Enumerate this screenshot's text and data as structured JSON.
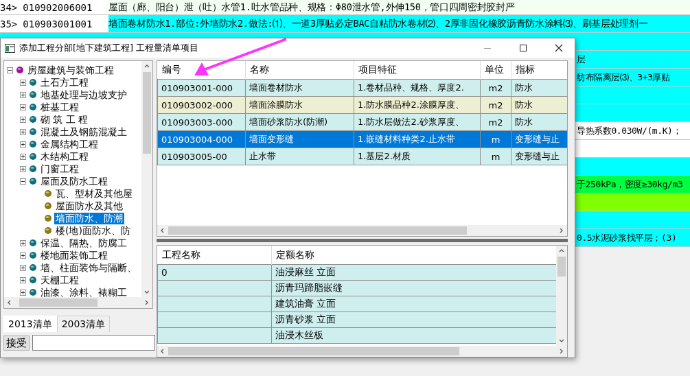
{
  "background_rows": [
    {
      "number": "34>",
      "code": "010902006001",
      "text": "屋面（廊、阳台）泄（吐）水管1.吐水管品种、规格：Φ80泄水管,外伸150，管口四周密封胶封严",
      "color": "#f4fff4"
    },
    {
      "number": "35>",
      "code": "010903001001",
      "text": "墙面卷材防水1.部位:外墙防水2.做法:⑴、一道3厚贴必定BAC自粘防水卷材⑵、2厚非固化橡胶沥青防水涂料⑶、刷基层处理剂一",
      "color": "#00ffff"
    },
    {
      "color": "#00ffff"
    },
    {
      "text": "层",
      "color": "#00ffff"
    },
    {
      "text": "纺布隔离层⑶、3+3厚贴",
      "color": "#00ffff"
    },
    {
      "color": "#00ffff"
    },
    {
      "color": "#00ffff"
    },
    {
      "text": "导热系数0.030W/(m.K)；",
      "color": "#ffffff"
    },
    {
      "color": "#ffffff"
    },
    {
      "color": "#00ffff"
    },
    {
      "text": "于250kPa，密度≥30kg/m3",
      "color": "#00ff40"
    },
    {
      "color": "#80ff00"
    },
    {
      "color": "#00ffff"
    },
    {
      "text": "0.5水泥砂浆找平层；(3)",
      "color": "#00ffff"
    }
  ],
  "window": {
    "title": "添加工程分部[地下建筑工程] 工程量清单项目"
  },
  "tree": [
    {
      "label": "房屋建筑与装饰工程",
      "expanded": true,
      "selected": false,
      "children": [
        {
          "label": "土石方工程",
          "expanded": false,
          "selected": false
        },
        {
          "label": "地基处理与边坡支护",
          "expanded": false,
          "selected": false
        },
        {
          "label": "桩基工程",
          "expanded": false,
          "selected": false
        },
        {
          "label": "砌 筑 工 程",
          "expanded": false,
          "selected": false
        },
        {
          "label": "混凝土及钢筋混凝土",
          "expanded": false,
          "selected": false
        },
        {
          "label": "金属结构工程",
          "expanded": false,
          "selected": false
        },
        {
          "label": "木结构工程",
          "expanded": false,
          "selected": false
        },
        {
          "label": "门窗工程",
          "expanded": false,
          "selected": false
        },
        {
          "label": "屋面及防水工程",
          "expanded": true,
          "selected": false,
          "children": [
            {
              "label": "瓦、型材及其他屋",
              "selected": false
            },
            {
              "label": "屋面防水及其他",
              "selected": false
            },
            {
              "label": "墙面防水、防潮",
              "selected": true
            },
            {
              "label": "楼(地)面防水、防",
              "selected": false
            }
          ]
        },
        {
          "label": "保温、隔热、防腐工",
          "expanded": false,
          "selected": false
        },
        {
          "label": "楼地面装饰工程",
          "expanded": false,
          "selected": false
        },
        {
          "label": "墙、柱面装饰与隔断、",
          "expanded": false,
          "selected": false
        },
        {
          "label": "天棚工程",
          "expanded": false,
          "selected": false
        },
        {
          "label": "油漆、涂料、裱糊工",
          "expanded": false,
          "selected": false
        }
      ]
    }
  ],
  "tabs": [
    {
      "label": "2013清单",
      "selected": true
    },
    {
      "label": "2003清单",
      "selected": false
    }
  ],
  "accept_button": "接受",
  "list_table": {
    "columns": [
      "编号",
      "名称",
      "项目特征",
      "单位",
      "指标"
    ],
    "rows": [
      {
        "cells": [
          "010903001-000",
          "墙面卷材防水",
          "1.卷材品种、规格、厚度2.",
          "m2",
          "防水"
        ],
        "selected": false,
        "color": "#cfeeee"
      },
      {
        "cells": [
          "010903002-000",
          "墙面涂膜防水",
          "1.防水膜品种2.涂膜厚度、",
          "m2",
          "防水"
        ],
        "selected": false,
        "color": "#eeeed2"
      },
      {
        "cells": [
          "010903003-000",
          "墙面砂浆防水(防潮)",
          "1.防水层做法2.砂浆厚度、",
          "m2",
          "防水"
        ],
        "selected": false,
        "color": "#cfeeee"
      },
      {
        "cells": [
          "010903004-000",
          "墙面变形缝",
          "1.嵌缝材料种类2.止水带",
          "m",
          "变形缝与止"
        ],
        "selected": true
      },
      {
        "cells": [
          "010903005-00",
          "止水带",
          "1.基层2.材质",
          "m",
          "变形缝与止"
        ],
        "selected": false,
        "color": "#cfeeee"
      }
    ]
  },
  "quota_table": {
    "columns": [
      "工程名称",
      "定额名称"
    ],
    "rows": [
      {
        "project": "0",
        "quota": "油浸麻丝  立面"
      },
      {
        "quota": "沥青玛蹄脂嵌缝"
      },
      {
        "quota": "建筑油膏  立面"
      },
      {
        "quota": "沥青砂浆  立面"
      },
      {
        "quota": "油浸木丝板"
      }
    ]
  }
}
